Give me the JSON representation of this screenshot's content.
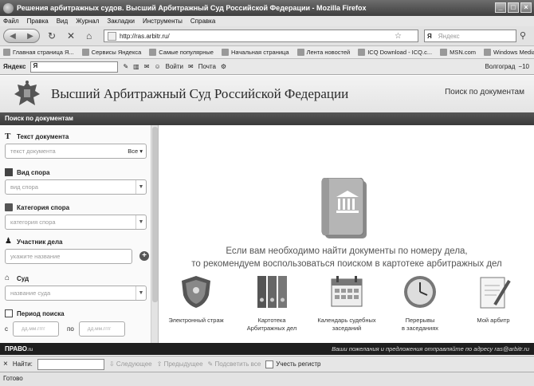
{
  "window": {
    "title": "Решения арбитражных судов. Высший Арбитражный Суд Российской Федерации - Mozilla Firefox",
    "buttons": [
      "_",
      "□",
      "×"
    ]
  },
  "menu": [
    "Файл",
    "Правка",
    "Вид",
    "Журнал",
    "Закладки",
    "Инструменты",
    "Справка"
  ],
  "navbar": {
    "url": "http://ras.arbitr.ru/",
    "search_engine": "Я",
    "search_placeholder": "Яндекс"
  },
  "bookmarks": [
    "Главная страница Я...",
    "Сервисы Яндекса",
    "Самые популярные",
    "Начальная страница",
    "Лента новостей",
    "ICQ Download - ICQ.c...",
    "MSN.com",
    "Windows Media"
  ],
  "yandex_bar": {
    "logo": "Яндекс",
    "input": "Я",
    "login": "Войти",
    "mail": "Почта",
    "city": "Волгоград",
    "temp": "−10"
  },
  "site": {
    "title": "Высший Арбитражный Суд Российской Федерации",
    "search_link": "Поиск по документам"
  },
  "section_title": "Поиск по документам",
  "filters": {
    "document_text": {
      "label": "Текст документа",
      "placeholder": "текст документа",
      "scope": "Все"
    },
    "dispute_type": {
      "label": "Вид спора",
      "placeholder": "вид спора"
    },
    "dispute_category": {
      "label": "Категория спора",
      "placeholder": "категория спора"
    },
    "participant": {
      "label": "Участник дела",
      "placeholder": "укажите название"
    },
    "court": {
      "label": "Суд",
      "placeholder": "название суда"
    },
    "period": {
      "label": "Период поиска",
      "from_label": "с",
      "to_label": "по",
      "date_placeholder": "дд.мм.гггг"
    }
  },
  "main": {
    "hint_line1": "Если вам необходимо найти документы по номеру дела,",
    "hint_line2": "то рекомендуем воспользоваться поиском в картотеке арбитражных дел",
    "tiles": [
      {
        "icon": "shield-icon",
        "label1": "Электронный страж",
        "label2": ""
      },
      {
        "icon": "binders-icon",
        "label1": "Картотека",
        "label2": "Арбитражных дел"
      },
      {
        "icon": "calendar-icon",
        "label1": "Календарь судебных",
        "label2": "заседаний"
      },
      {
        "icon": "clock-icon",
        "label1": "Перерывы",
        "label2": "в заседаниях"
      },
      {
        "icon": "document-pen-icon",
        "label1": "Мой арбитр",
        "label2": ""
      }
    ]
  },
  "footer": {
    "brand": "ПРАВО",
    "brand_suffix": ".ru",
    "feedback": "Ваши пожелания и предложения отправляйте по адресу",
    "email": "ras@arbitr.ru"
  },
  "findbar": {
    "close": "×",
    "label": "Найти:",
    "next": "Следующее",
    "prev": "Предыдущее",
    "highlight": "Подсветить все",
    "match_case": "Учесть регистр"
  },
  "status": "Готово"
}
